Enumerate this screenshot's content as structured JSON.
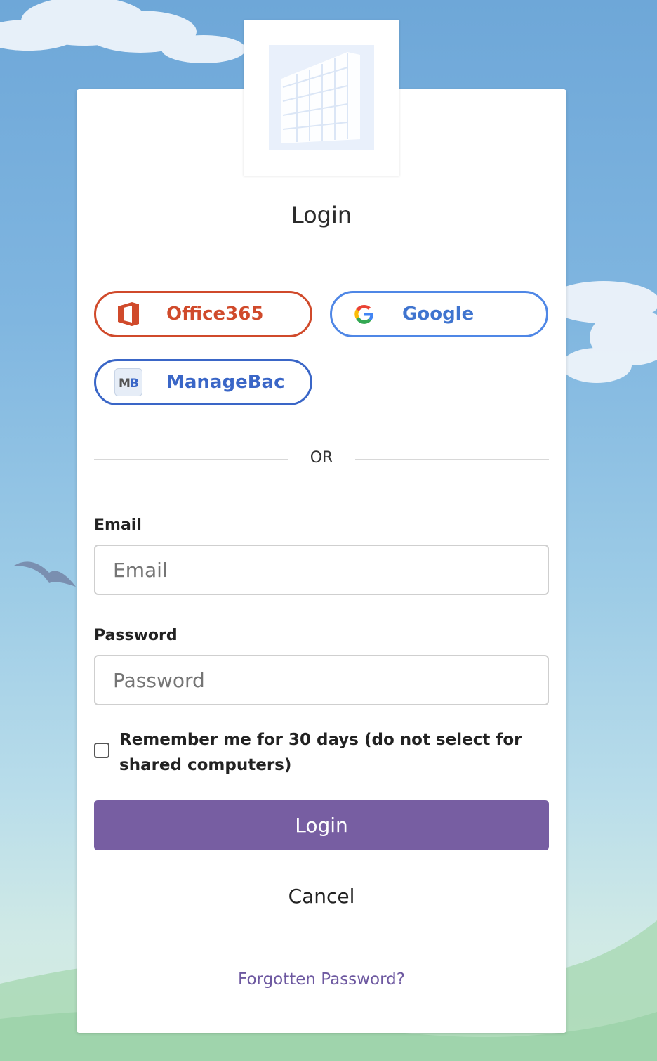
{
  "page": {
    "title": "Login"
  },
  "sso": {
    "office365": {
      "label": "Office365",
      "icon": "office365-icon",
      "color": "#d04a2b"
    },
    "google": {
      "label": "Google",
      "icon": "google-icon",
      "color": "#4f87e6"
    },
    "managebac": {
      "label": "ManageBac",
      "icon": "managebac-icon",
      "color": "#3a66c7"
    }
  },
  "divider": {
    "text": "OR"
  },
  "form": {
    "email": {
      "label": "Email",
      "placeholder": "Email",
      "value": ""
    },
    "password": {
      "label": "Password",
      "placeholder": "Password",
      "value": ""
    },
    "remember": {
      "label": "Remember me for 30 days (do not select for shared computers)",
      "checked": false
    },
    "submit_label": "Login",
    "submit_color": "#775ea2",
    "cancel_label": "Cancel",
    "forgot_label": "Forgotten Password?"
  }
}
